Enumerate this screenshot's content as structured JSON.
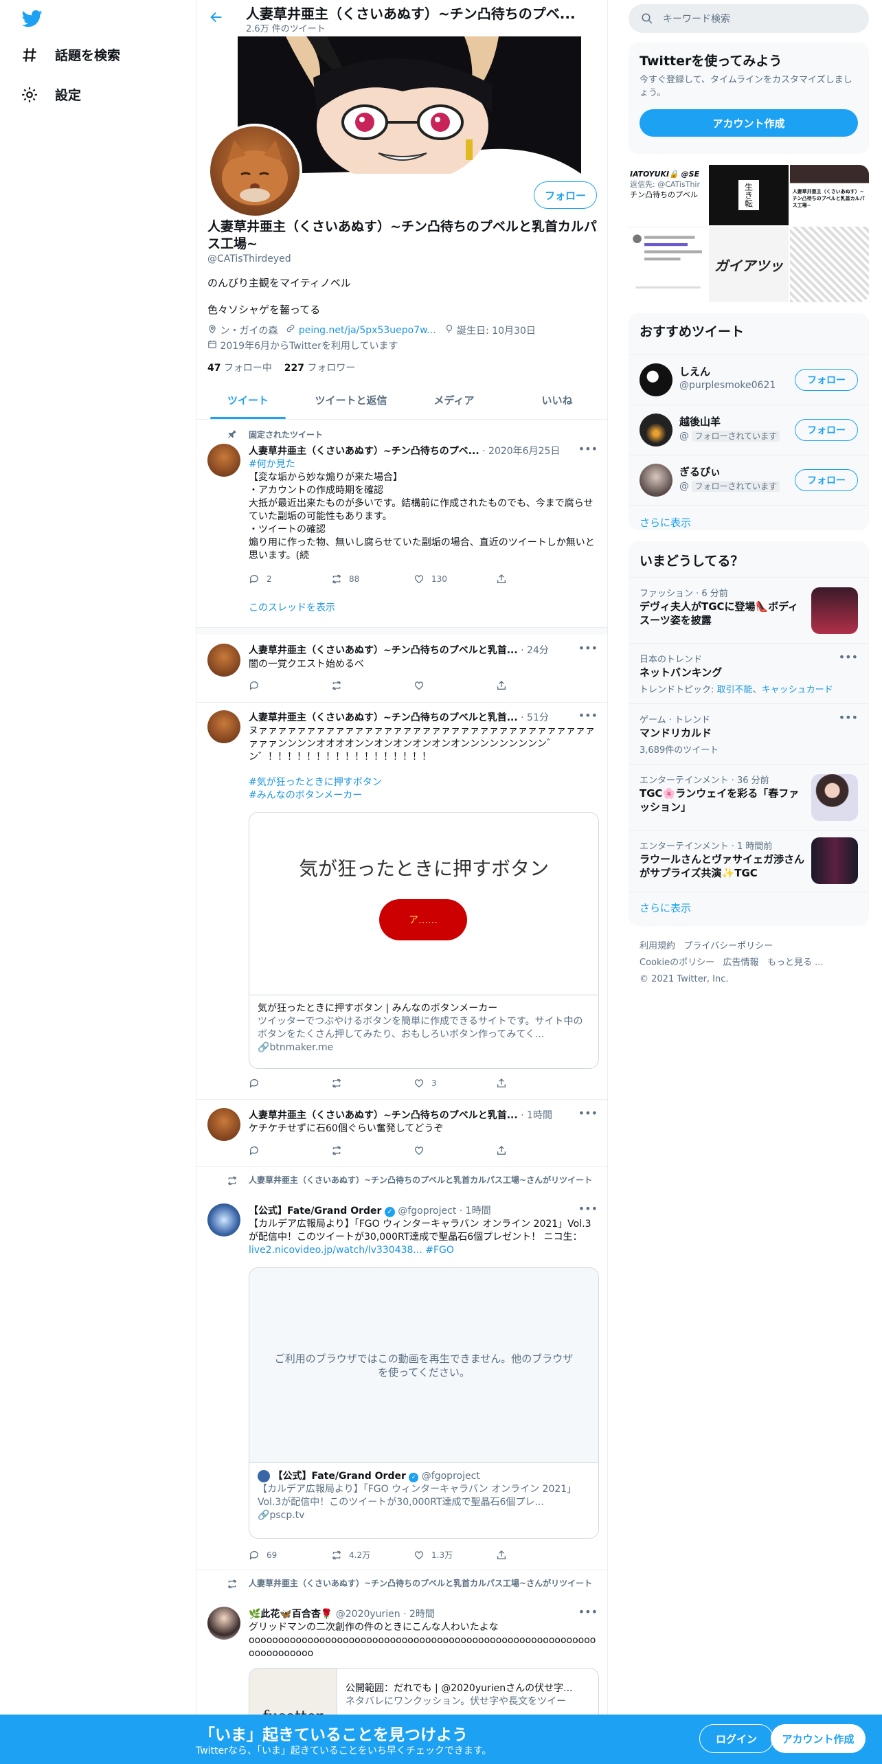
{
  "nav": {
    "explore": "話題を検索",
    "settings": "設定"
  },
  "profile": {
    "header_title": "人妻草井亜主（くさいあぬす）~チン凸待ちのプベ...",
    "tweet_count": "2.6万 件のツイート",
    "follow_button": "フォロー",
    "name": "人妻草井亜主（くさいあぬす）~チン凸待ちのプベルと乳首カルパス工場~",
    "handle": "@CATisThirdeyed",
    "bio_line1": "のんびり主観をマイティノベル",
    "bio_line2": "色々ソシャゲを齧ってる",
    "location": "ン・ガイの森",
    "link": "peing.net/ja/5px53uepo7w...",
    "birthday": "誕生日: 10月30日",
    "joined": "2019年6月からTwitterを利用しています",
    "following_count": "47",
    "following_label": "フォロー中",
    "followers_count": "227",
    "followers_label": "フォロワー"
  },
  "tabs": [
    "ツイート",
    "ツイートと返信",
    "メディア",
    "いいね"
  ],
  "tweets": {
    "t1": {
      "context": "固定されたツイート",
      "name": "人妻草井亜主（くさいあぬす）~チン凸待ちのプベ...",
      "date": "· 2020年6月25日",
      "hashtag": "#何か見た",
      "body": "【変な垢から妙な煽りが来た場合】\n・アカウントの作成時期を確認\n大抵が最近出来たものが多いです。結構前に作成されたものでも、今まで腐らせていた副垢の可能性もあります。\n・ツイートの確認\n煽り用に作った物、無いし腐らせていた副垢の場合、直近のツイートしか無いと思います。(続",
      "replies": "2",
      "retweets": "88",
      "likes": "130",
      "show_thread": "このスレッドを表示"
    },
    "t2": {
      "name": "人妻草井亜主（くさいあぬす）~チン凸待ちのプベルと乳首...",
      "time": "· 24分",
      "body": "闇の一覚クエスト始めるべ"
    },
    "t3": {
      "name": "人妻草井亜主（くさいあぬす）~チン凸待ちのプベルと乳首...",
      "time": "· 51分",
      "body": "ヌァァァァァァァァァァァァァァァァァァァァァァァァァァァァァァァァァァァァァァンンンンオオオオンンオンオンオンオンオンンンンンンンンン゛ン゛！！！！！！！！！！！！！！！！！",
      "hashtag1": "#気が狂ったときに押すボタン",
      "hashtag2": "#みんなのボタンメーカー",
      "card_heading": "気が狂ったときに押すボタン",
      "card_button": "ア……",
      "card_title": "気が狂ったときに押すボタン | みんなのボタンメーカー",
      "card_desc": "ツイッターでつぶやけるボタンを簡単に作成できるサイトです。サイト中のボタンをたくさん押してみたり、おもしろいボタン作ってみてく...",
      "card_domain": "btnmaker.me",
      "likes": "3"
    },
    "t4": {
      "name": "人妻草井亜主（くさいあぬす）~チン凸待ちのプベルと乳首...",
      "time": "· 1時間",
      "body": "ケチケチせずに石60個ぐらい奮発してどうぞ"
    },
    "t5": {
      "context": "人妻草井亜主（くさいあぬす）~チン凸待ちのプベルと乳首カルパス工場~さんがリツイート",
      "name": "【公式】Fate/Grand Order",
      "handle": "@fgoproject",
      "time": "· 1時間",
      "body": "【カルデア広報局より】「FGO ウィンターキャラバン オンライン 2021」Vol.3が配信中！このツイートが30,000RT達成で聖晶石6個プレゼント！ ニコ生：",
      "link": "live2.nicovideo.jp/watch/lv330438...",
      "hashtag": "#FGO",
      "video_msg": "ご利用のブラウザではこの動画を再生できません。他のブラウザを使ってください。",
      "quote_name": "【公式】Fate/Grand Order",
      "quote_handle": "@fgoproject",
      "quote_body": "【カルデア広報局より】「FGO ウィンターキャラバン オンライン 2021」Vol.3が配信中！このツイートが30,000RT達成で聖晶石6個プレ...",
      "quote_domain": "pscp.tv",
      "replies": "69",
      "retweets": "4.2万",
      "likes": "1.3万"
    },
    "t6": {
      "context": "人妻草井亜主（くさいあぬす）~チン凸待ちのプベルと乳首カルパス工場~さんがリツイート",
      "name": "🌿此花🦋百合杏🌹",
      "handle": "@2020yurien",
      "time": "· 2時間",
      "body": "グリッドマンの二次創作の件のときにこんな人わいたよな",
      "body2": "oooooooooooooooooooooooooooooooooooooooooooooooooooooooooooooooooooooo",
      "card_img_text": "fusetter",
      "card_title": "公開範囲：だれでも | @2020yurienさんの伏せ字...",
      "card_desc": "ネタバレにワンクッション。伏せ字や長文をツイー"
    }
  },
  "right": {
    "search_placeholder": "キーワード検索",
    "try_title": "Twitterを使ってみよう",
    "try_desc": "今すぐ登録して、タイムラインをカスタマイズしましょう。",
    "create_account": "アカウント作成",
    "media_texts": {
      "a": "IATOYUKI🔒 @SE",
      "b": "返信先: @CATisThir",
      "c": "チン凸待ちのプベル",
      "d": "生き転",
      "e": "ガイアツッ",
      "f": "人妻草井亜主（くさいあぬす）~チン凸待ちのプベルと乳首カルパス工場~"
    },
    "rec_title": "おすすめツイート",
    "rec": [
      {
        "name": "しえん",
        "handle": "@purplesmoke0621",
        "follow": "フォロー"
      },
      {
        "name": "越後山羊",
        "handle": "@",
        "badge": "フォローされています",
        "follow": "フォロー"
      },
      {
        "name": "ぎるぴぃ",
        "handle": "@",
        "badge": "フォローされています",
        "follow": "フォロー"
      }
    ],
    "show_more": "さらに表示",
    "trend_title": "いまどうしてる？",
    "trends": [
      {
        "meta": "ファッション · 6 分前",
        "title": "デヴィ夫人がTGCに登場👠ボディスーツ姿を披露"
      },
      {
        "meta": "日本のトレンド",
        "title": "ネットバンキング",
        "sub_label": "トレンドトピック:",
        "sub1": "取引不能",
        "sub2": "キャッシュカード"
      },
      {
        "meta": "ゲーム · トレンド",
        "title": "マンドリカルド",
        "count": "3,689件のツイート"
      },
      {
        "meta": "エンターテインメント · 36 分前",
        "title": "TGC🌸ランウェイを彩る「春ファッション」"
      },
      {
        "meta": "エンターテインメント · 1 時間前",
        "title": "ラウールさんとヴァサイェガ渉さんがサプライズ共演✨TGC"
      }
    ],
    "footer": {
      "terms": "利用規約",
      "privacy": "プライバシーポリシー",
      "cookie": "Cookieのポリシー",
      "ads": "広告情報",
      "more": "もっと見る ...",
      "copyright": "© 2021 Twitter, Inc."
    }
  },
  "bottom": {
    "headline": "「いま」起きていることを見つけよう",
    "sub": "Twitterなら、「いま」起きていることをいち早くチェックできます。",
    "login": "ログイン",
    "signup": "アカウント作成"
  }
}
